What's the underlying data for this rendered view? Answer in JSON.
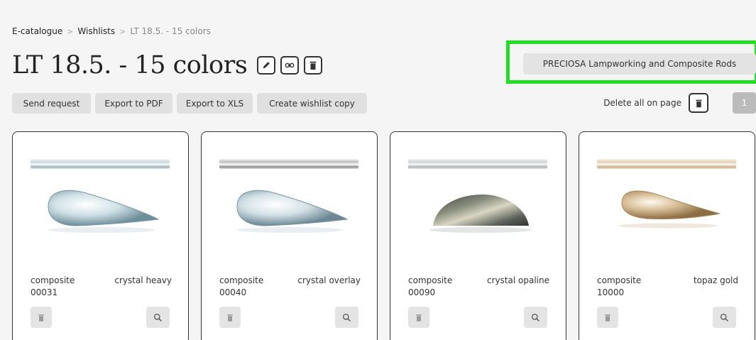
{
  "breadcrumb": {
    "items": [
      "E-catalogue",
      "Wishlists",
      "LT 18.5. - 15 colors"
    ],
    "separator": ">"
  },
  "page": {
    "title": "LT 18.5. - 15 colors"
  },
  "category": {
    "label": "PRECIOSA Lampworking and Composite Rods",
    "highlight_color": "#22dd22"
  },
  "toolbar": {
    "send_request": "Send request",
    "export_pdf": "Export to PDF",
    "export_xls": "Export to XLS",
    "create_copy": "Create wishlist copy"
  },
  "delete_all": {
    "label": "Delete all on page"
  },
  "pagination": {
    "current": "1"
  },
  "products": [
    {
      "type": "composite",
      "color_name": "crystal heavy",
      "code": "00031",
      "image": "clear-teardrop-rod"
    },
    {
      "type": "composite",
      "color_name": "crystal overlay",
      "code": "00040",
      "image": "clear-teardrop-rod"
    },
    {
      "type": "composite",
      "color_name": "crystal opaline",
      "code": "00090",
      "image": "opaline-half-disc-rod"
    },
    {
      "type": "composite",
      "color_name": "topaz gold",
      "code": "10000",
      "image": "topaz-teardrop-rod"
    }
  ],
  "icons": {
    "edit": "pencil-icon",
    "link": "link-icon",
    "delete": "trash-icon",
    "zoom": "magnifier-icon"
  }
}
